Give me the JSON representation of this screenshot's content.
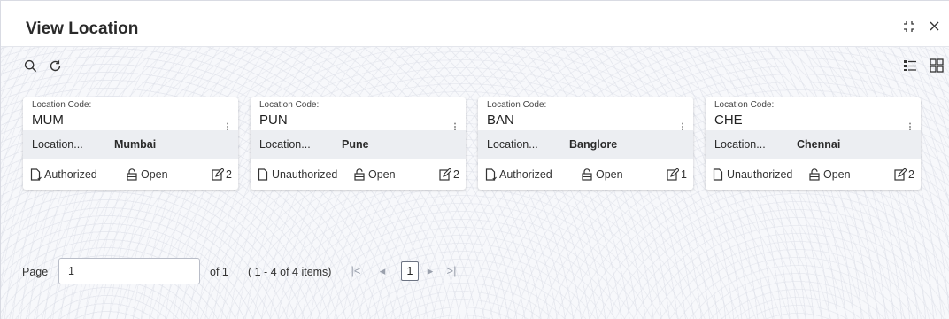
{
  "header": {
    "title": "View Location"
  },
  "cards": [
    {
      "label": "Location Code:",
      "code": "MUM",
      "desc_label": "Location...",
      "desc_value": "Mumbai",
      "status": "Authorized",
      "status_icon": "authorized-doc-icon",
      "open": "Open",
      "count": "2"
    },
    {
      "label": "Location Code:",
      "code": "PUN",
      "desc_label": "Location...",
      "desc_value": "Pune",
      "status": "Unauthorized",
      "status_icon": "unauthorized-doc-icon",
      "open": "Open",
      "count": "2"
    },
    {
      "label": "Location Code:",
      "code": "BAN",
      "desc_label": "Location...",
      "desc_value": "Banglore",
      "status": "Authorized",
      "status_icon": "authorized-doc-icon",
      "open": "Open",
      "count": "1"
    },
    {
      "label": "Location Code:",
      "code": "CHE",
      "desc_label": "Location...",
      "desc_value": "Chennai",
      "status": "Unauthorized",
      "status_icon": "unauthorized-doc-icon",
      "open": "Open",
      "count": "2"
    }
  ],
  "pagination": {
    "page_label": "Page",
    "page_value": "1",
    "of_label": "of 1",
    "items_label": "( 1 - 4 of 4 items)",
    "current_page": "1"
  },
  "colors": {
    "accent": "#2a2a2a",
    "band": "#eceef2",
    "background": "#f7f8fb"
  }
}
